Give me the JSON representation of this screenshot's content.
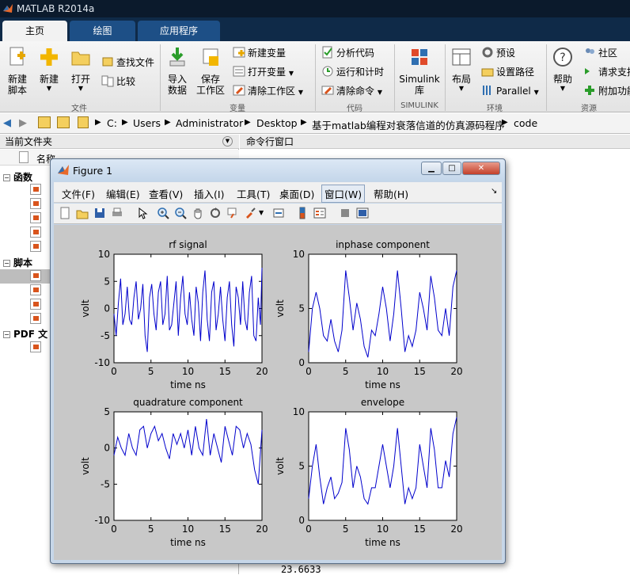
{
  "app": {
    "title": "MATLAB R2014a"
  },
  "tabs": [
    {
      "label": "主页"
    },
    {
      "label": "绘图"
    },
    {
      "label": "应用程序"
    }
  ],
  "ribbon": {
    "new_script": "新建\n脚本",
    "new": "新建",
    "open": "打开",
    "find_files": "查找文件",
    "compare": "比较",
    "import": "导入\n数据",
    "save_ws": "保存\n工作区",
    "new_var": "新建变量",
    "open_var": "打开变量",
    "clear_ws": "清除工作区",
    "analyze": "分析代码",
    "run_time": "运行和计时",
    "clear_cmd": "清除命令",
    "simulink": "Simulink\n库",
    "layout": "布局",
    "prefs": "预设",
    "set_path": "设置路径",
    "parallel": "Parallel",
    "help": "帮助",
    "community": "社区",
    "request": "请求支持",
    "addons": "附加功能",
    "groups": {
      "file": "文件",
      "variable": "变量",
      "code": "代码",
      "simulink": "SIMULINK",
      "env": "环境",
      "resources": "资源"
    }
  },
  "address": {
    "parts": [
      "C:",
      "Users",
      "Administrator",
      "Desktop",
      "基于matlab编程对衰落信道的仿真源码程序",
      "code"
    ]
  },
  "left_panel": {
    "title": "当前文件夹",
    "column": "名称",
    "sections": [
      {
        "label": "函数"
      },
      {
        "label": "脚本"
      },
      {
        "label": "PDF 文"
      }
    ]
  },
  "right_panel": {
    "title": "命令行窗口",
    "last_value": "23.6633"
  },
  "figure": {
    "title": "Figure 1",
    "menus": [
      "文件(F)",
      "编辑(E)",
      "查看(V)",
      "插入(I)",
      "工具(T)",
      "桌面(D)",
      "窗口(W)",
      "帮助(H)"
    ]
  },
  "chart_data": [
    {
      "type": "line",
      "title": "rf signal",
      "xlabel": "time ns",
      "ylabel": "volt",
      "xlim": [
        0,
        20
      ],
      "ylim": [
        -10,
        10
      ],
      "xticks": [
        "0",
        "5",
        "10",
        "15",
        "20"
      ],
      "yticks": [
        "-10",
        "-5",
        "0",
        "5",
        "10"
      ],
      "color": "#0000cc",
      "x": [
        0,
        0.3,
        0.6,
        0.9,
        1.2,
        1.5,
        1.8,
        2.1,
        2.4,
        2.7,
        3.0,
        3.3,
        3.6,
        3.9,
        4.2,
        4.5,
        4.8,
        5.1,
        5.4,
        5.7,
        6.0,
        6.3,
        6.6,
        6.9,
        7.2,
        7.5,
        7.8,
        8.1,
        8.4,
        8.7,
        9.0,
        9.3,
        9.6,
        9.9,
        10.2,
        10.5,
        10.8,
        11.1,
        11.4,
        11.7,
        12.0,
        12.3,
        12.6,
        12.9,
        13.2,
        13.5,
        13.8,
        14.1,
        14.4,
        14.7,
        15.0,
        15.3,
        15.6,
        15.9,
        16.2,
        16.5,
        16.8,
        17.1,
        17.4,
        17.7,
        18.0,
        18.3,
        18.6,
        18.9,
        19.2,
        19.5,
        19.8,
        20.0
      ],
      "values": [
        -1,
        -5,
        1,
        5.5,
        -3,
        -1,
        4,
        -2,
        -3,
        2,
        5,
        -2,
        0,
        4.5,
        -5,
        -8,
        2,
        4.5,
        -1,
        -4,
        3,
        5,
        -3,
        -1,
        6,
        -4,
        -3,
        1,
        5,
        -5,
        2,
        6,
        -1,
        -3,
        3,
        -2,
        -5,
        4,
        1,
        -6,
        3,
        7,
        -2,
        -6,
        3,
        5,
        -4,
        -1,
        4,
        -2,
        -6,
        2,
        5,
        -3,
        -7,
        4,
        2,
        -3,
        5,
        -2,
        -4,
        3,
        6,
        -5,
        -6,
        2,
        -3,
        7.5
      ]
    },
    {
      "type": "line",
      "title": "inphase component",
      "xlabel": "time ns",
      "ylabel": "volt",
      "xlim": [
        0,
        20
      ],
      "ylim": [
        0,
        10
      ],
      "xticks": [
        "0",
        "5",
        "10",
        "15",
        "20"
      ],
      "yticks": [
        "0",
        "5",
        "10"
      ],
      "color": "#0000cc",
      "x": [
        0,
        0.5,
        1,
        1.5,
        2,
        2.5,
        3,
        3.5,
        4,
        4.5,
        5,
        5.5,
        6,
        6.5,
        7,
        7.5,
        8,
        8.5,
        9,
        9.5,
        10,
        10.5,
        11,
        11.5,
        12,
        12.5,
        13,
        13.5,
        14,
        14.5,
        15,
        15.5,
        16,
        16.5,
        17,
        17.5,
        18,
        18.5,
        19,
        19.5,
        20
      ],
      "values": [
        1,
        5,
        6.5,
        5,
        2.5,
        2,
        4,
        2,
        1,
        3,
        8.5,
        6,
        3,
        5.5,
        4,
        1.5,
        0.5,
        3,
        2.5,
        4.5,
        7,
        5,
        2,
        4.5,
        8.5,
        5,
        1,
        2.5,
        1.5,
        3,
        6.5,
        5,
        3,
        8,
        6,
        3,
        2.5,
        5,
        2.5,
        7,
        8.5
      ]
    },
    {
      "type": "line",
      "title": "quadrature component",
      "xlabel": "time ns",
      "ylabel": "volt",
      "xlim": [
        0,
        20
      ],
      "ylim": [
        -10,
        5
      ],
      "xticks": [
        "0",
        "5",
        "10",
        "15",
        "20"
      ],
      "yticks": [
        "-10",
        "-5",
        "0",
        "5"
      ],
      "color": "#0000cc",
      "x": [
        0,
        0.5,
        1,
        1.5,
        2,
        2.5,
        3,
        3.5,
        4,
        4.5,
        5,
        5.5,
        6,
        6.5,
        7,
        7.5,
        8,
        8.5,
        9,
        9.5,
        10,
        10.5,
        11,
        11.5,
        12,
        12.5,
        13,
        13.5,
        14,
        14.5,
        15,
        15.5,
        16,
        16.5,
        17,
        17.5,
        18,
        18.5,
        19,
        19.5,
        20
      ],
      "values": [
        -1,
        1.5,
        0,
        -1,
        2,
        0,
        -1,
        2.5,
        3,
        0,
        2,
        3,
        1,
        2,
        0,
        -1.5,
        2,
        0.5,
        2,
        0,
        2.5,
        -1,
        3,
        0,
        -1,
        4,
        -1,
        2,
        0,
        -2,
        3,
        1,
        -1,
        3,
        2.5,
        0,
        2,
        0.5,
        -3,
        -5,
        2.5
      ]
    },
    {
      "type": "line",
      "title": "envelope",
      "xlabel": "time ns",
      "ylabel": "volt",
      "xlim": [
        0,
        20
      ],
      "ylim": [
        0,
        10
      ],
      "xticks": [
        "0",
        "5",
        "10",
        "15",
        "20"
      ],
      "yticks": [
        "0",
        "5",
        "10"
      ],
      "color": "#0000cc",
      "x": [
        0,
        0.5,
        1,
        1.5,
        2,
        2.5,
        3,
        3.5,
        4,
        4.5,
        5,
        5.5,
        6,
        6.5,
        7,
        7.5,
        8,
        8.5,
        9,
        9.5,
        10,
        10.5,
        11,
        11.5,
        12,
        12.5,
        13,
        13.5,
        14,
        14.5,
        15,
        15.5,
        16,
        16.5,
        17,
        17.5,
        18,
        18.5,
        19,
        19.5,
        20
      ],
      "values": [
        2,
        5,
        7,
        4,
        1.5,
        3,
        4,
        2,
        2.5,
        3.5,
        8.5,
        6.5,
        3,
        5,
        4,
        2,
        1.5,
        3,
        3,
        5,
        7,
        5,
        3,
        5,
        8.5,
        5,
        1.5,
        3,
        2,
        3,
        7,
        5,
        3,
        8.5,
        6.5,
        3,
        3,
        5.5,
        4,
        8,
        9.5
      ]
    }
  ]
}
